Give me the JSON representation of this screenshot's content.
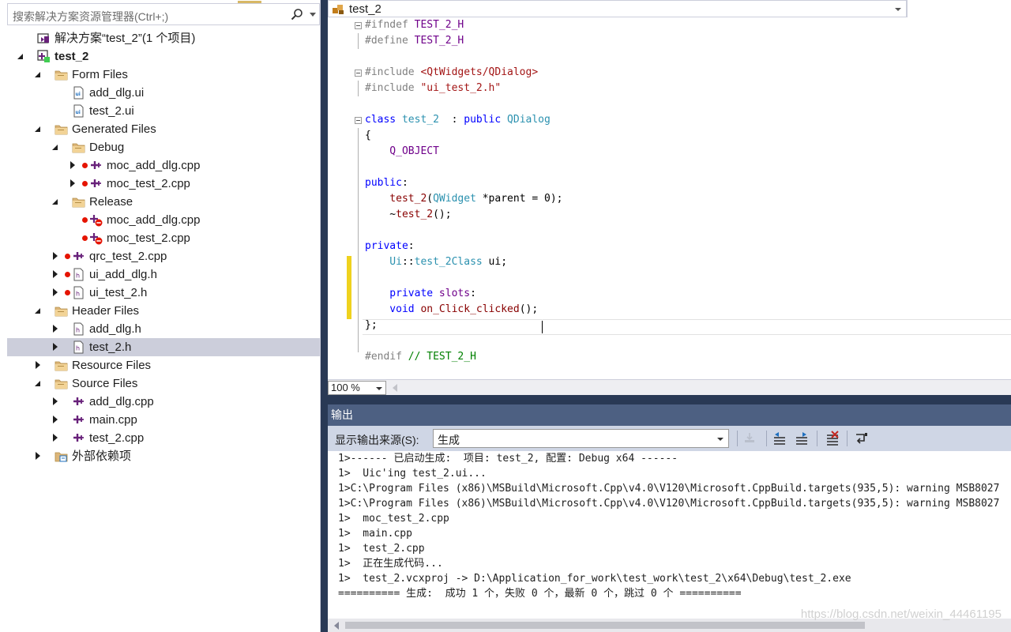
{
  "solution_explorer": {
    "search_placeholder": "搜索解决方案资源管理器(Ctrl+;)",
    "items": [
      {
        "label": "解决方案“test_2”(1 个项目)",
        "icon": "solution-icon",
        "expander": "none",
        "level": 0
      },
      {
        "label": "test_2",
        "icon": "qt-project-icon",
        "expander": "down",
        "level": 0,
        "bold": true
      },
      {
        "label": "Form Files",
        "icon": "filter-folder-icon",
        "expander": "down",
        "level": 1
      },
      {
        "label": "add_dlg.ui",
        "icon": "ui-file-icon",
        "expander": "none",
        "level": 2
      },
      {
        "label": "test_2.ui",
        "icon": "ui-file-icon",
        "expander": "none",
        "level": 2
      },
      {
        "label": "Generated Files",
        "icon": "filter-folder-icon",
        "expander": "down",
        "level": 1
      },
      {
        "label": "Debug",
        "icon": "filter-folder-icon",
        "expander": "down",
        "level": 2
      },
      {
        "label": "moc_add_dlg.cpp",
        "icon": "cpp-file-icon",
        "expander": "right",
        "level": 3,
        "excluded": true
      },
      {
        "label": "moc_test_2.cpp",
        "icon": "cpp-file-icon",
        "expander": "right",
        "level": 3,
        "excluded": true
      },
      {
        "label": "Release",
        "icon": "filter-folder-icon",
        "expander": "down",
        "level": 2
      },
      {
        "label": "moc_add_dlg.cpp",
        "icon": "cpp-excluded-file-icon",
        "expander": "none",
        "level": 3,
        "excluded": true
      },
      {
        "label": "moc_test_2.cpp",
        "icon": "cpp-excluded-file-icon",
        "expander": "none",
        "level": 3,
        "excluded": true
      },
      {
        "label": "qrc_test_2.cpp",
        "icon": "cpp-file-icon",
        "expander": "right",
        "level": 2,
        "excluded": true
      },
      {
        "label": "ui_add_dlg.h",
        "icon": "header-file-icon",
        "expander": "right",
        "level": 2,
        "excluded": true
      },
      {
        "label": "ui_test_2.h",
        "icon": "header-file-icon",
        "expander": "right",
        "level": 2,
        "excluded": true
      },
      {
        "label": "Header Files",
        "icon": "filter-folder-icon",
        "expander": "down",
        "level": 1
      },
      {
        "label": "add_dlg.h",
        "icon": "header-file-icon",
        "expander": "right",
        "level": 2
      },
      {
        "label": "test_2.h",
        "icon": "header-file-icon",
        "expander": "right",
        "level": 2,
        "selected": true
      },
      {
        "label": "Resource Files",
        "icon": "filter-folder-icon",
        "expander": "right",
        "level": 1
      },
      {
        "label": "Source Files",
        "icon": "filter-folder-icon",
        "expander": "down",
        "level": 1
      },
      {
        "label": "add_dlg.cpp",
        "icon": "cpp-file-icon",
        "expander": "right",
        "level": 2
      },
      {
        "label": "main.cpp",
        "icon": "cpp-file-icon",
        "expander": "right",
        "level": 2
      },
      {
        "label": "test_2.cpp",
        "icon": "cpp-file-icon",
        "expander": "right",
        "level": 2
      },
      {
        "label": "外部依赖项",
        "icon": "external-deps-icon",
        "expander": "right",
        "level": 1
      }
    ]
  },
  "editor": {
    "nav_scope": "test_2",
    "zoom": "100 %",
    "lines": [
      [
        [
          "pp",
          "#ifndef "
        ],
        [
          "mac",
          "TEST_2_H"
        ]
      ],
      [
        [
          "pp",
          "#define "
        ],
        [
          "mac",
          "TEST_2_H"
        ]
      ],
      [],
      [
        [
          "pp",
          "#include "
        ],
        [
          "str",
          "<QtWidgets/QDialog>"
        ]
      ],
      [
        [
          "pp",
          "#include "
        ],
        [
          "str",
          "\"ui_test_2.h\""
        ]
      ],
      [],
      [
        [
          "kw",
          "class "
        ],
        [
          "typ",
          "test_2"
        ],
        [
          "",
          "  : "
        ],
        [
          "kw",
          "public "
        ],
        [
          "typ",
          "QDialog"
        ]
      ],
      [
        [
          "",
          "{"
        ]
      ],
      [
        [
          "mac",
          "    Q_OBJECT"
        ]
      ],
      [],
      [
        [
          "kw",
          "public"
        ],
        [
          "",
          ":"
        ]
      ],
      [
        [
          "fn",
          "    test_2"
        ],
        [
          "",
          "("
        ],
        [
          "typ",
          "QWidget"
        ],
        [
          "",
          " *parent = 0);"
        ]
      ],
      [
        [
          "",
          "    ~"
        ],
        [
          "fn",
          "test_2"
        ],
        [
          "",
          "();"
        ]
      ],
      [],
      [
        [
          "kw",
          "private"
        ],
        [
          "",
          ":"
        ]
      ],
      [
        [
          "typ",
          "    Ui"
        ],
        [
          "",
          "::"
        ],
        [
          "typ",
          "test_2Class"
        ],
        [
          "",
          " ui;"
        ]
      ],
      [],
      [
        [
          "kw",
          "    private "
        ],
        [
          "mac",
          "slots"
        ],
        [
          "",
          ":"
        ]
      ],
      [
        [
          "kw",
          "    void "
        ],
        [
          "fn",
          "on_Click_clicked"
        ],
        [
          "",
          "();"
        ]
      ],
      [
        [
          "",
          "};"
        ]
      ],
      [],
      [
        [
          "pp",
          "#endif "
        ],
        [
          "cm",
          "// TEST_2_H"
        ]
      ]
    ]
  },
  "output": {
    "title": "输出",
    "source_label": "显示输出来源(S):",
    "source_value": "生成",
    "lines": [
      "1>------ 已启动生成:  项目: test_2, 配置: Debug x64 ------",
      "1>  Uic'ing test_2.ui...",
      "1>C:\\Program Files (x86)\\MSBuild\\Microsoft.Cpp\\v4.0\\V120\\Microsoft.CppBuild.targets(935,5): warning MSB8027",
      "1>C:\\Program Files (x86)\\MSBuild\\Microsoft.Cpp\\v4.0\\V120\\Microsoft.CppBuild.targets(935,5): warning MSB8027",
      "1>  moc_test_2.cpp",
      "1>  main.cpp",
      "1>  test_2.cpp",
      "1>  正在生成代码...",
      "1>  test_2.vcxproj -> D:\\Application_for_work\\test_work\\test_2\\x64\\Debug\\test_2.exe",
      "========== 生成:  成功 1 个，失败 0 个，最新 0 个，跳过 0 个 =========="
    ],
    "watermark": "https://blog.csdn.net/weixin_44461195"
  },
  "colors": {
    "accent_title": "#4d6082",
    "selection": "#cccedb",
    "change_bar": "#efd21e",
    "excluded_dot": "#e51400"
  }
}
